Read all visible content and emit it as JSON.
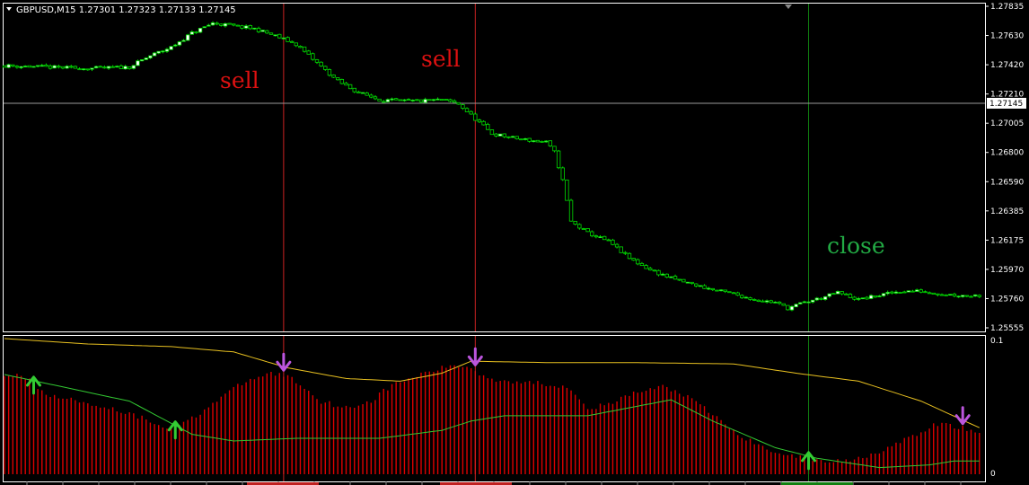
{
  "header": {
    "symbol_line": "GBPUSD,M15  1.27301 1.27323 1.27133 1.27145"
  },
  "colors": {
    "background": "#000000",
    "frame": "#ffffff",
    "bull_candle": "#ffffff",
    "bear_candle": "#00dd00",
    "wick": "#00dd00",
    "histogram": "#dd0000",
    "upper_line": "#e8c020",
    "lower_line": "#32c832",
    "up_arrow": "#33cc33",
    "down_arrow": "#bb55dd",
    "sell_text": "#dd1111",
    "close_text": "#22aa44",
    "sell_vline": "#cc2222",
    "close_vline": "#108010",
    "bid_line": "#9a9a9a"
  },
  "chart_data": [
    {
      "type": "candlestick",
      "symbol": "GBPUSD",
      "timeframe": "M15",
      "ohlc_current": {
        "open": 1.27301,
        "high": 1.27323,
        "low": 1.27133,
        "close": 1.27145
      },
      "ylim": [
        1.25555,
        1.27835
      ],
      "y_ticks": [
        "1.27835",
        "1.27630",
        "1.27420",
        "1.27210",
        "1.27005",
        "1.26800",
        "1.26590",
        "1.26385",
        "1.26175",
        "1.25970",
        "1.25760",
        "1.25555"
      ],
      "current_price_label": "1.27145",
      "grid": false,
      "close_anchor_points": [
        [
          0,
          1.2741
        ],
        [
          10,
          1.274
        ],
        [
          20,
          1.2739
        ],
        [
          30,
          1.274
        ],
        [
          35,
          1.2748
        ],
        [
          40,
          1.2754
        ],
        [
          45,
          1.2764
        ],
        [
          50,
          1.2771
        ],
        [
          55,
          1.2769
        ],
        [
          60,
          1.2767
        ],
        [
          65,
          1.2762
        ],
        [
          70,
          1.2756
        ],
        [
          75,
          1.2743
        ],
        [
          80,
          1.273
        ],
        [
          85,
          1.2722
        ],
        [
          90,
          1.2717
        ],
        [
          95,
          1.2716
        ],
        [
          100,
          1.2716
        ],
        [
          105,
          1.2717
        ],
        [
          109,
          1.2714
        ],
        [
          112,
          1.2706
        ],
        [
          117,
          1.2693
        ],
        [
          122,
          1.269
        ],
        [
          127,
          1.2688
        ],
        [
          130,
          1.2687
        ],
        [
          132,
          1.268
        ],
        [
          134,
          1.266
        ],
        [
          136,
          1.2631
        ],
        [
          140,
          1.2623
        ],
        [
          145,
          1.2617
        ],
        [
          150,
          1.2605
        ],
        [
          155,
          1.2597
        ],
        [
          160,
          1.2591
        ],
        [
          165,
          1.2587
        ],
        [
          170,
          1.2583
        ],
        [
          175,
          1.258
        ],
        [
          180,
          1.2576
        ],
        [
          185,
          1.2574
        ],
        [
          188,
          1.257
        ],
        [
          192,
          1.2574
        ],
        [
          197,
          1.2578
        ],
        [
          200,
          1.2581
        ],
        [
          205,
          1.2576
        ],
        [
          210,
          1.2579
        ],
        [
          215,
          1.2582
        ],
        [
          220,
          1.2582
        ],
        [
          225,
          1.258
        ],
        [
          230,
          1.2579
        ],
        [
          234,
          1.2579
        ]
      ],
      "annotations": [
        {
          "text": "sell",
          "bar": 67,
          "price": 1.274
        },
        {
          "text": "sell",
          "bar": 113,
          "price": 1.2754
        },
        {
          "text": "close",
          "bar": 202,
          "price": 1.2615
        }
      ],
      "vertical_lines": [
        {
          "bar": 67,
          "kind": "sell"
        },
        {
          "bar": 113,
          "kind": "sell"
        },
        {
          "bar": 193,
          "kind": "close"
        }
      ]
    },
    {
      "type": "histogram_with_bands",
      "ylim": [
        0,
        0.1
      ],
      "y_ticks": [
        "0.1",
        "0"
      ],
      "histogram_anchor_points": [
        [
          0,
          0.075
        ],
        [
          4,
          0.075
        ],
        [
          8,
          0.065
        ],
        [
          12,
          0.058
        ],
        [
          18,
          0.055
        ],
        [
          25,
          0.05
        ],
        [
          30,
          0.046
        ],
        [
          35,
          0.04
        ],
        [
          40,
          0.035
        ],
        [
          45,
          0.042
        ],
        [
          52,
          0.058
        ],
        [
          58,
          0.07
        ],
        [
          64,
          0.076
        ],
        [
          68,
          0.074
        ],
        [
          72,
          0.065
        ],
        [
          76,
          0.055
        ],
        [
          82,
          0.05
        ],
        [
          88,
          0.055
        ],
        [
          92,
          0.065
        ],
        [
          98,
          0.073
        ],
        [
          103,
          0.078
        ],
        [
          108,
          0.082
        ],
        [
          112,
          0.08
        ],
        [
          116,
          0.072
        ],
        [
          122,
          0.07
        ],
        [
          130,
          0.068
        ],
        [
          136,
          0.065
        ],
        [
          140,
          0.05
        ],
        [
          145,
          0.052
        ],
        [
          150,
          0.06
        ],
        [
          158,
          0.066
        ],
        [
          163,
          0.06
        ],
        [
          170,
          0.045
        ],
        [
          176,
          0.03
        ],
        [
          182,
          0.02
        ],
        [
          190,
          0.013
        ],
        [
          196,
          0.01
        ],
        [
          202,
          0.01
        ],
        [
          208,
          0.015
        ],
        [
          212,
          0.02
        ],
        [
          218,
          0.028
        ],
        [
          224,
          0.038
        ],
        [
          230,
          0.035
        ],
        [
          234,
          0.03
        ]
      ],
      "upper_band_points": [
        [
          0,
          0.102
        ],
        [
          20,
          0.098
        ],
        [
          40,
          0.096
        ],
        [
          55,
          0.092
        ],
        [
          68,
          0.08
        ],
        [
          82,
          0.072
        ],
        [
          95,
          0.07
        ],
        [
          105,
          0.076
        ],
        [
          112,
          0.085
        ],
        [
          130,
          0.084
        ],
        [
          150,
          0.084
        ],
        [
          175,
          0.083
        ],
        [
          190,
          0.076
        ],
        [
          205,
          0.07
        ],
        [
          220,
          0.055
        ],
        [
          234,
          0.035
        ]
      ],
      "lower_band_points": [
        [
          0,
          0.075
        ],
        [
          15,
          0.065
        ],
        [
          30,
          0.055
        ],
        [
          45,
          0.03
        ],
        [
          55,
          0.025
        ],
        [
          70,
          0.027
        ],
        [
          90,
          0.027
        ],
        [
          105,
          0.033
        ],
        [
          112,
          0.04
        ],
        [
          120,
          0.044
        ],
        [
          140,
          0.044
        ],
        [
          150,
          0.05
        ],
        [
          160,
          0.056
        ],
        [
          170,
          0.04
        ],
        [
          185,
          0.02
        ],
        [
          195,
          0.012
        ],
        [
          210,
          0.005
        ],
        [
          222,
          0.007
        ],
        [
          228,
          0.01
        ],
        [
          234,
          0.01
        ]
      ],
      "arrows": [
        {
          "bar": 7,
          "dir": "up"
        },
        {
          "bar": 41,
          "dir": "up"
        },
        {
          "bar": 67,
          "dir": "down"
        },
        {
          "bar": 113,
          "dir": "down"
        },
        {
          "bar": 193,
          "dir": "up"
        },
        {
          "bar": 230,
          "dir": "down"
        }
      ]
    }
  ]
}
